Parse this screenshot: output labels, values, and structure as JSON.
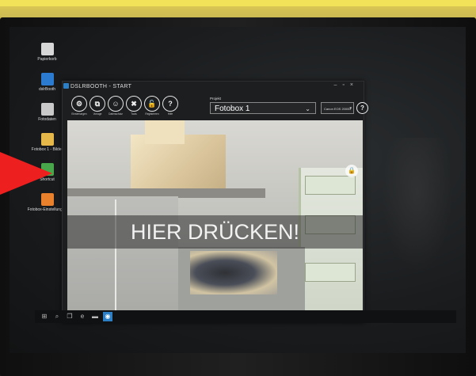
{
  "desktop": {
    "icons": [
      {
        "label": "Papierkorb",
        "icon": "recycle-bin-icon",
        "color": "#d7d7d7"
      },
      {
        "label": "dslrBooth",
        "icon": "dslrbooth-app-icon",
        "color": "#2b7bd1"
      },
      {
        "label": "Fotodaten",
        "icon": "user-folder-icon",
        "color": "#c9c9c9"
      },
      {
        "label": "Fotobox 1 - Bilder",
        "icon": "folder-icon",
        "color": "#e6b84a"
      },
      {
        "label": "Shortcut",
        "icon": "shortcut-icon",
        "color": "#47a74a"
      },
      {
        "label": "Fotobox-Einstellungen",
        "icon": "orange-app-icon",
        "color": "#e8802c"
      }
    ]
  },
  "app": {
    "title": "DSLRBOOTH - START",
    "window_controls": [
      "–",
      "▫",
      "×"
    ],
    "toolbar": [
      {
        "label": "Einstellungen",
        "icon": "gear-icon",
        "glyph": "⚙"
      },
      {
        "label": "Vorlage",
        "icon": "template-icon",
        "glyph": "⧉"
      },
      {
        "label": "Datenschutz",
        "icon": "person-icon",
        "glyph": "☺"
      },
      {
        "label": "Tools",
        "icon": "tools-icon",
        "glyph": "✖"
      },
      {
        "label": "Registrieren",
        "icon": "unlock-icon",
        "glyph": "🔓"
      },
      {
        "label": "Hilfe",
        "icon": "help-icon",
        "glyph": "?"
      }
    ],
    "project_label": "Projekt",
    "project_value": "Fotobox 1",
    "camera_value": "Canon EOS 2000D",
    "help_glyph": "?",
    "banner_text": "HIER DRÜCKEN!",
    "lock_glyph": "🔒"
  },
  "taskbar": [
    {
      "icon": "windows-start-icon",
      "glyph": "⊞"
    },
    {
      "icon": "search-icon",
      "glyph": "⌕"
    },
    {
      "icon": "task-view-icon",
      "glyph": "❒"
    },
    {
      "icon": "edge-icon",
      "glyph": "e"
    },
    {
      "icon": "explorer-icon",
      "glyph": "▬"
    },
    {
      "icon": "dslrbooth-taskbar-icon",
      "glyph": "◉"
    }
  ],
  "colors": {
    "arrow": "#ee1f1f",
    "accent": "#2c7fc5"
  }
}
